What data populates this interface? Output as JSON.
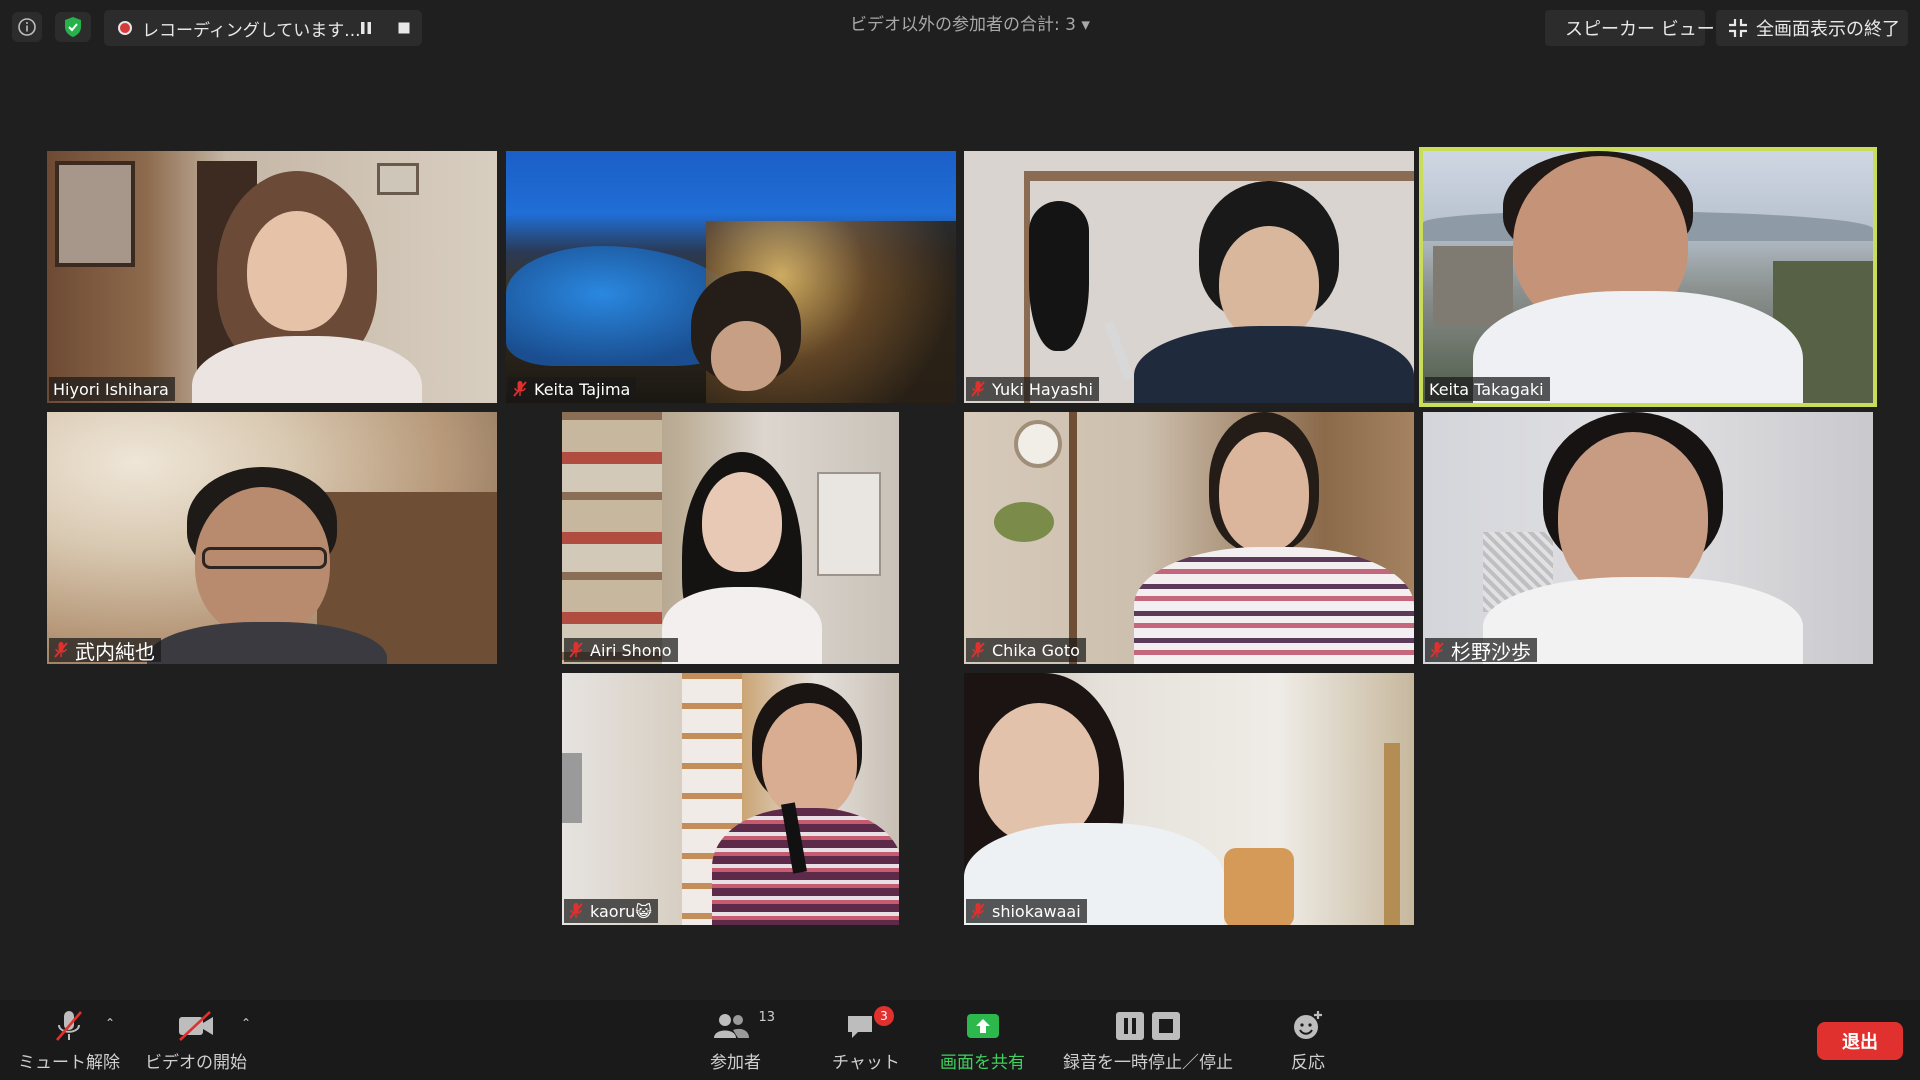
{
  "top": {
    "recording_label": "レコーディングしています...",
    "participants_count": "ビデオ以外の参加者の合計: 3 ▾",
    "speaker_view_label": "スピーカー ビュー",
    "exit_fullscreen_label": "全画面表示の終了"
  },
  "tiles": [
    {
      "name": "Hiyori Ishihara",
      "muted": false
    },
    {
      "name": "Keita Tajima",
      "muted": true
    },
    {
      "name": "Yuki Hayashi",
      "muted": true
    },
    {
      "name": "Keita Takagaki",
      "muted": false,
      "active_speaker": true
    },
    {
      "name": "武内純也",
      "muted": true
    },
    {
      "name": "Airi Shono",
      "muted": true
    },
    {
      "name": "Chika Goto",
      "muted": true
    },
    {
      "name": "杉野沙歩",
      "muted": true
    },
    {
      "name": "kaoru😺",
      "muted": true
    },
    {
      "name": "shiokawaai",
      "muted": true
    }
  ],
  "toolbar": {
    "unmute_label": "ミュート解除",
    "start_video_label": "ビデオの開始",
    "participants_label": "参加者",
    "participants_count": "13",
    "chat_label": "チャット",
    "chat_badge": "3",
    "share_label": "画面を共有",
    "pause_stop_recording_label": "録音を一時停止／停止",
    "reactions_label": "反応",
    "leave_label": "退出"
  },
  "colors": {
    "background": "#1f1f1f",
    "active_speaker_border": "#c9dd5a",
    "share_green": "#3fd25e",
    "leave_red": "#e0312e",
    "muted_red": "#e0312e"
  }
}
